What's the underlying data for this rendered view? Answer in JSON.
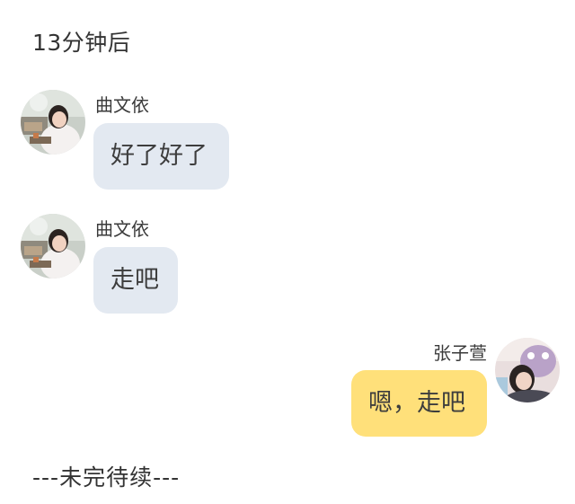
{
  "time_divider": "13分钟后",
  "messages": [
    {
      "sender": "曲文依",
      "text": "好了好了",
      "side": "left",
      "avatar": "profile-photo-quwenyi"
    },
    {
      "sender": "曲文依",
      "text": "走吧",
      "side": "left",
      "avatar": "profile-photo-quwenyi"
    },
    {
      "sender": "张子萱",
      "text": "嗯，走吧",
      "side": "right",
      "avatar": "profile-photo-zhangzixuan"
    }
  ],
  "footer": "---未完待续---",
  "colors": {
    "incoming_bubble": "#e3e9f1",
    "outgoing_bubble": "#ffe07a",
    "background": "#ffffff"
  }
}
